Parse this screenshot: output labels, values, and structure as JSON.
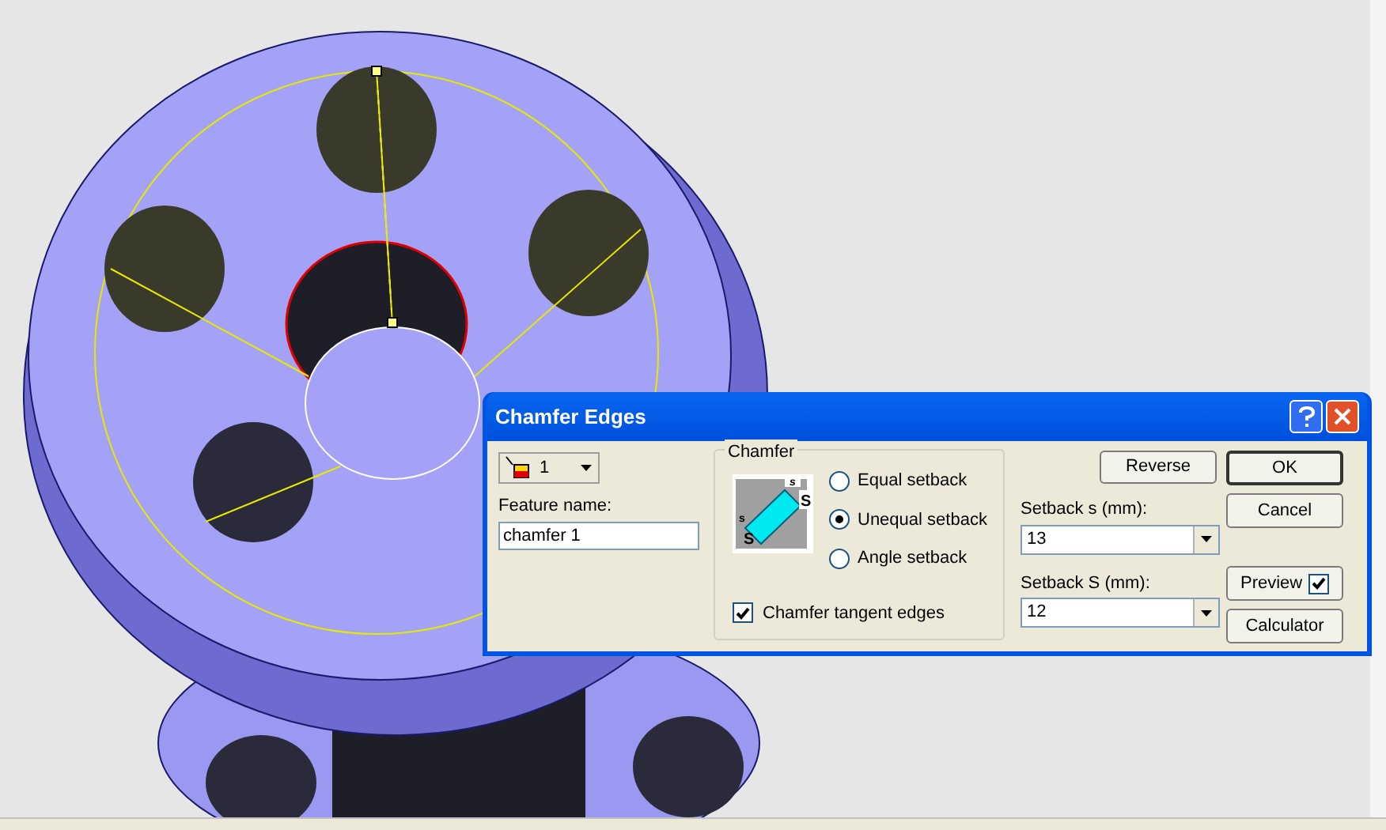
{
  "dialog": {
    "title": "Chamfer Edges",
    "selector": {
      "value": "1"
    },
    "feature_name": {
      "label": "Feature name:",
      "value": "chamfer 1"
    },
    "chamfer": {
      "title": "Chamfer",
      "diagram_labels": [
        "s",
        "S",
        "s",
        "S"
      ],
      "options": [
        {
          "label": "Equal setback",
          "selected": false
        },
        {
          "label": "Unequal setback",
          "selected": true
        },
        {
          "label": "Angle setback",
          "selected": false
        }
      ],
      "tangent_edges": {
        "label": "Chamfer tangent edges",
        "checked": true
      }
    },
    "reverse_button": "Reverse",
    "setbacks": [
      {
        "label": "Setback s (mm):",
        "value": "13"
      },
      {
        "label": "Setback S (mm):",
        "value": "12"
      }
    ],
    "ok_button": "OK",
    "cancel_button": "Cancel",
    "preview": {
      "label": "Preview",
      "checked": true
    },
    "calculator_button": "Calculator"
  }
}
